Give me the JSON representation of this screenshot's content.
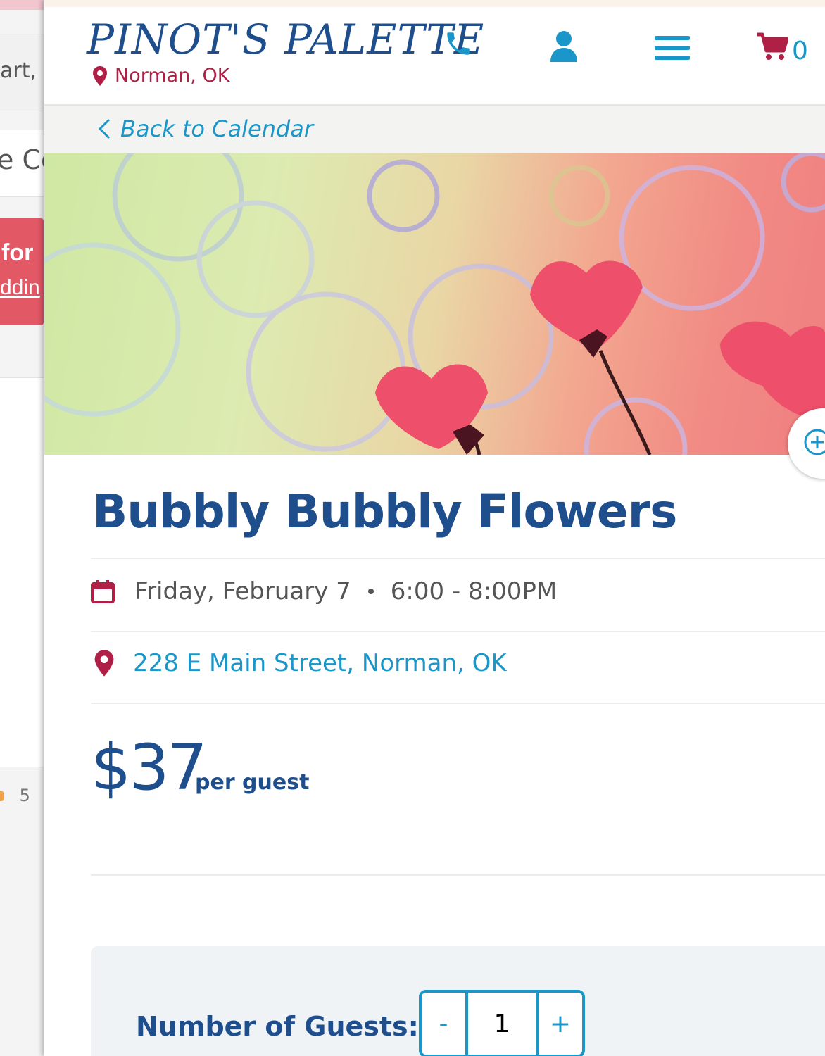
{
  "background_page": {
    "snippet_1": "art, ",
    "snippet_2": "e Co",
    "banner_line_1": "for ",
    "banner_line_2": "ddin",
    "rating_count": "5"
  },
  "header": {
    "logo_text": "PINOT'S PALETTE",
    "location": "Norman, OK",
    "cart_count": "0"
  },
  "nav": {
    "back_label": "Back to Calendar"
  },
  "event": {
    "title": "Bubbly Bubbly Flowers",
    "date": "Friday, February 7",
    "time": "6:00 - 8:00PM",
    "address": "228 E Main Street, Norman, OK",
    "price": "$37",
    "price_unit": "per guest"
  },
  "guests": {
    "label": "Number of Guests:",
    "decrement": "-",
    "value": "1",
    "increment": "+"
  },
  "colors": {
    "brand_blue": "#1f4e8c",
    "link_blue": "#1a96c9",
    "accent_red": "#b01f45"
  }
}
